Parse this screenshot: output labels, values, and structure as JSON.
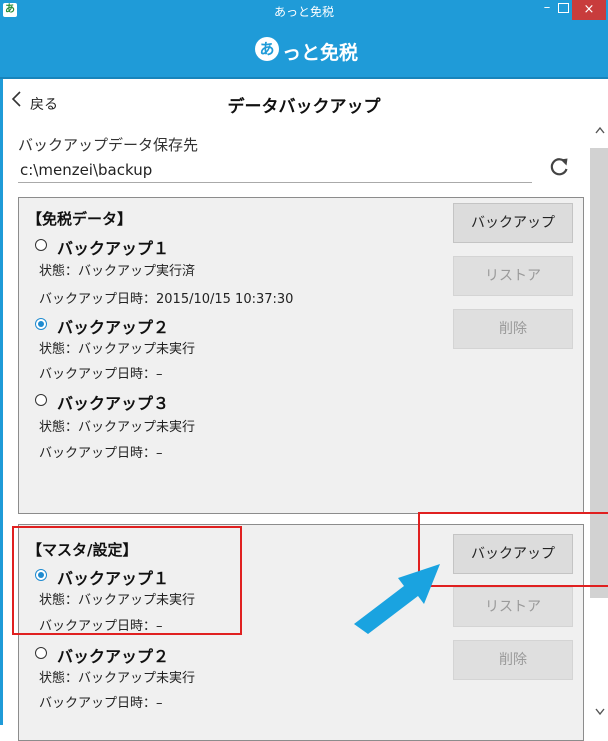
{
  "window": {
    "app_icon": "あ",
    "title": "あっと免税",
    "minimize": "–",
    "close": "×"
  },
  "header": {
    "brand_mark": "あ",
    "brand": "っと免税"
  },
  "nav": {
    "back_label": "戻る",
    "page_title": "データバックアップ"
  },
  "storage": {
    "label": "バックアップデータ保存先",
    "path": "c:\\menzei\\backup"
  },
  "icons": {
    "back": "chevron-left-icon",
    "refresh": "refresh-icon",
    "scroll_up": "caret-up-icon",
    "scroll_down": "caret-down-icon"
  },
  "sections": [
    {
      "heading": "【免税データ】",
      "slots": [
        {
          "name": "バックアップ１",
          "selected": false,
          "status": "状態：バックアップ実行済",
          "date": "バックアップ日時：2015/10/15 10:37:30"
        },
        {
          "name": "バックアップ２",
          "selected": true,
          "status": "状態：バックアップ未実行",
          "date": "バックアップ日時：–"
        },
        {
          "name": "バックアップ３",
          "selected": false,
          "status": "状態：バックアップ未実行",
          "date": "バックアップ日時：–"
        }
      ],
      "buttons": {
        "backup": "バックアップ",
        "restore": "リストア",
        "delete": "削除"
      }
    },
    {
      "heading": "【マスタ/設定】",
      "slots": [
        {
          "name": "バックアップ１",
          "selected": true,
          "status": "状態：バックアップ未実行",
          "date": "バックアップ日時：–"
        },
        {
          "name": "バックアップ２",
          "selected": false,
          "status": "状態：バックアップ未実行",
          "date": "バックアップ日時：–"
        }
      ],
      "buttons": {
        "backup": "バックアップ",
        "restore": "リストア",
        "delete": "削除"
      }
    }
  ],
  "colors": {
    "accent": "#1f9bd8",
    "close": "#c83c3c",
    "highlight": "#e02020",
    "arrow": "#1aa3e0"
  }
}
